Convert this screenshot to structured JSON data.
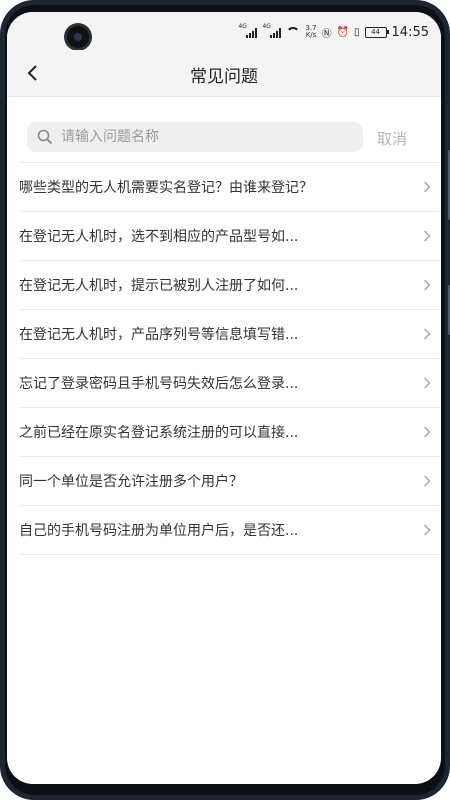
{
  "status_bar": {
    "signal1_tag": "4G",
    "signal2_tag": "4G",
    "speed_value": "3.7",
    "speed_unit": "K/s",
    "battery": "44",
    "time": "14:55"
  },
  "header": {
    "title": "常见问题"
  },
  "search": {
    "placeholder": "请输入问题名称",
    "cancel_label": "取消"
  },
  "faq_items": [
    {
      "label": "哪些类型的无人机需要实名登记？由谁来登记？"
    },
    {
      "label": "在登记无人机时，选不到相应的产品型号如..."
    },
    {
      "label": "在登记无人机时，提示已被别人注册了如何..."
    },
    {
      "label": "在登记无人机时，产品序列号等信息填写错..."
    },
    {
      "label": "忘记了登录密码且手机号码失效后怎么登录..."
    },
    {
      "label": "之前已经在原实名登记系统注册的可以直接..."
    },
    {
      "label": "同一个单位是否允许注册多个用户？"
    },
    {
      "label": "自己的手机号码注册为单位用户后，是否还..."
    }
  ],
  "icons": {
    "back": "chevron-left-icon",
    "search": "search-icon",
    "item_arrow": "chevron-right-icon"
  },
  "colors": {
    "header_bg": "#f4f4f4",
    "search_bg": "#efefef",
    "cancel_text": "#b5b5b5",
    "divider": "#e8e8e8"
  }
}
